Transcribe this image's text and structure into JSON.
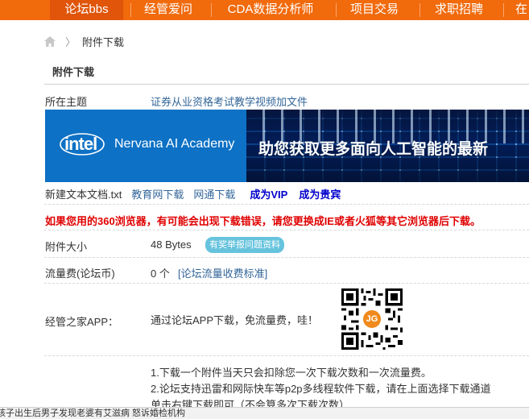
{
  "nav": {
    "items": [
      "论坛bbs",
      "经管爱问",
      "CDA数据分析师",
      "项目交易",
      "求职招聘",
      "在"
    ],
    "active_index": 0,
    "bg_color": "#f16a0c"
  },
  "breadcrumb": {
    "home_icon": "home-icon",
    "separator": "〉",
    "current": "附件下载"
  },
  "section_title": "附件下载",
  "topic": {
    "label": "所在主题",
    "value": "证券从业资格考试教学视频加文件"
  },
  "banner": {
    "logo_text": "intel",
    "product_text": "Nervana AI Academy",
    "headline": "助您获取更多面向人工智能的最新"
  },
  "file": {
    "name": "新建文本文档.txt",
    "links": [
      "教育网下载",
      "网通下载"
    ],
    "vip_links": [
      "成为VIP",
      "成为贵宾"
    ]
  },
  "warning": "如果您用的360浏览器，有可能会出现下载错误，请您更换成IE或者火狐等其它浏览器后下载。",
  "size": {
    "label": "附件大小",
    "value": "48 Bytes",
    "badge": "有奖举报问题资料"
  },
  "fee": {
    "label": "流量费(论坛币)",
    "value": "0 个",
    "link": "[论坛流量收费标准]"
  },
  "app": {
    "label": "经管之家APP：",
    "text": "通过论坛APP下载，免流量费，哇！",
    "qr_logo": "JG"
  },
  "notes": [
    "1.下载一个附件当天只会扣除您一次下载次数和一次流量费。",
    "2.论坛支持迅雷和网际快车等p2p多线程软件下载，请在上面选择下载通道",
    "单击右键下载即可（不会算多次下载次数）"
  ],
  "status_bar": "孩子出生后男子发现老婆有艾滋病 怒诉婚检机构"
}
